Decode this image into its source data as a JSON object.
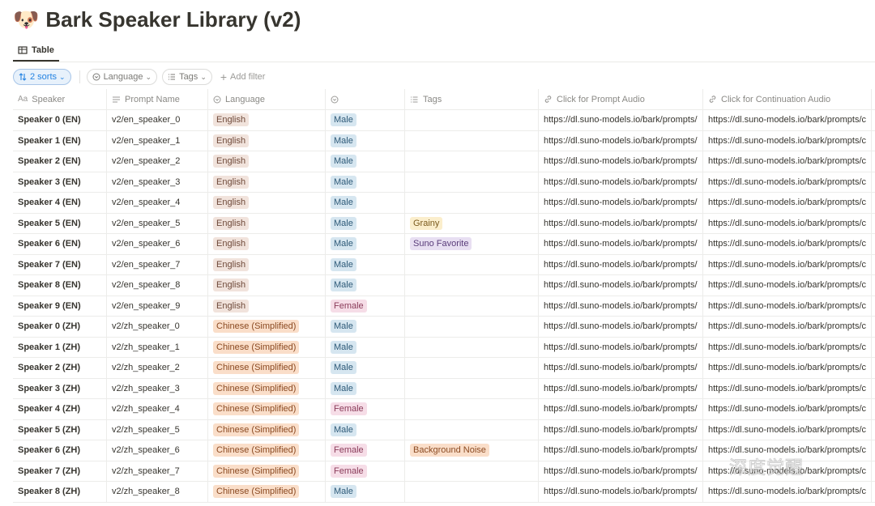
{
  "page": {
    "icon": "🐶",
    "title": "Bark Speaker Library (v2)"
  },
  "tabs": [
    {
      "label": "Table",
      "icon": "table-icon"
    }
  ],
  "filters": {
    "sort_label": "2 sorts",
    "language_label": "Language",
    "tags_label": "Tags",
    "add_filter_label": "Add filter"
  },
  "columns": [
    {
      "label": "Speaker",
      "icon": "text-icon"
    },
    {
      "label": "Prompt Name",
      "icon": "lines-icon"
    },
    {
      "label": "Language",
      "icon": "select-icon"
    },
    {
      "label": "",
      "icon": "select-icon"
    },
    {
      "label": "Tags",
      "icon": "list-icon"
    },
    {
      "label": "Click for Prompt Audio",
      "icon": "link-icon"
    },
    {
      "label": "Click for Continuation Audio",
      "icon": "link-icon"
    }
  ],
  "rows": [
    {
      "speaker": "Speaker 0 (EN)",
      "prompt": "v2/en_speaker_0",
      "language": "English",
      "gender": "Male",
      "tag": "",
      "prompt_url": "https://dl.suno-models.io/bark/prompts/",
      "cont_url": "https://dl.suno-models.io/bark/prompts/c"
    },
    {
      "speaker": "Speaker 1 (EN)",
      "prompt": "v2/en_speaker_1",
      "language": "English",
      "gender": "Male",
      "tag": "",
      "prompt_url": "https://dl.suno-models.io/bark/prompts/",
      "cont_url": "https://dl.suno-models.io/bark/prompts/c"
    },
    {
      "speaker": "Speaker 2 (EN)",
      "prompt": "v2/en_speaker_2",
      "language": "English",
      "gender": "Male",
      "tag": "",
      "prompt_url": "https://dl.suno-models.io/bark/prompts/",
      "cont_url": "https://dl.suno-models.io/bark/prompts/c"
    },
    {
      "speaker": "Speaker 3 (EN)",
      "prompt": "v2/en_speaker_3",
      "language": "English",
      "gender": "Male",
      "tag": "",
      "prompt_url": "https://dl.suno-models.io/bark/prompts/",
      "cont_url": "https://dl.suno-models.io/bark/prompts/c"
    },
    {
      "speaker": "Speaker 4 (EN)",
      "prompt": "v2/en_speaker_4",
      "language": "English",
      "gender": "Male",
      "tag": "",
      "prompt_url": "https://dl.suno-models.io/bark/prompts/",
      "cont_url": "https://dl.suno-models.io/bark/prompts/c"
    },
    {
      "speaker": "Speaker 5 (EN)",
      "prompt": "v2/en_speaker_5",
      "language": "English",
      "gender": "Male",
      "tag": "Grainy",
      "prompt_url": "https://dl.suno-models.io/bark/prompts/",
      "cont_url": "https://dl.suno-models.io/bark/prompts/c"
    },
    {
      "speaker": "Speaker 6 (EN)",
      "prompt": "v2/en_speaker_6",
      "language": "English",
      "gender": "Male",
      "tag": "Suno Favorite",
      "prompt_url": "https://dl.suno-models.io/bark/prompts/",
      "cont_url": "https://dl.suno-models.io/bark/prompts/c"
    },
    {
      "speaker": "Speaker 7 (EN)",
      "prompt": "v2/en_speaker_7",
      "language": "English",
      "gender": "Male",
      "tag": "",
      "prompt_url": "https://dl.suno-models.io/bark/prompts/",
      "cont_url": "https://dl.suno-models.io/bark/prompts/c"
    },
    {
      "speaker": "Speaker 8 (EN)",
      "prompt": "v2/en_speaker_8",
      "language": "English",
      "gender": "Male",
      "tag": "",
      "prompt_url": "https://dl.suno-models.io/bark/prompts/",
      "cont_url": "https://dl.suno-models.io/bark/prompts/c"
    },
    {
      "speaker": "Speaker 9 (EN)",
      "prompt": "v2/en_speaker_9",
      "language": "English",
      "gender": "Female",
      "tag": "",
      "prompt_url": "https://dl.suno-models.io/bark/prompts/",
      "cont_url": "https://dl.suno-models.io/bark/prompts/c"
    },
    {
      "speaker": "Speaker 0 (ZH)",
      "prompt": "v2/zh_speaker_0",
      "language": "Chinese (Simplified)",
      "gender": "Male",
      "tag": "",
      "prompt_url": "https://dl.suno-models.io/bark/prompts/",
      "cont_url": "https://dl.suno-models.io/bark/prompts/c"
    },
    {
      "speaker": "Speaker 1 (ZH)",
      "prompt": "v2/zh_speaker_1",
      "language": "Chinese (Simplified)",
      "gender": "Male",
      "tag": "",
      "prompt_url": "https://dl.suno-models.io/bark/prompts/",
      "cont_url": "https://dl.suno-models.io/bark/prompts/c"
    },
    {
      "speaker": "Speaker 2 (ZH)",
      "prompt": "v2/zh_speaker_2",
      "language": "Chinese (Simplified)",
      "gender": "Male",
      "tag": "",
      "prompt_url": "https://dl.suno-models.io/bark/prompts/",
      "cont_url": "https://dl.suno-models.io/bark/prompts/c"
    },
    {
      "speaker": "Speaker 3 (ZH)",
      "prompt": "v2/zh_speaker_3",
      "language": "Chinese (Simplified)",
      "gender": "Male",
      "tag": "",
      "prompt_url": "https://dl.suno-models.io/bark/prompts/",
      "cont_url": "https://dl.suno-models.io/bark/prompts/c"
    },
    {
      "speaker": "Speaker 4 (ZH)",
      "prompt": "v2/zh_speaker_4",
      "language": "Chinese (Simplified)",
      "gender": "Female",
      "tag": "",
      "prompt_url": "https://dl.suno-models.io/bark/prompts/",
      "cont_url": "https://dl.suno-models.io/bark/prompts/c"
    },
    {
      "speaker": "Speaker 5 (ZH)",
      "prompt": "v2/zh_speaker_5",
      "language": "Chinese (Simplified)",
      "gender": "Male",
      "tag": "",
      "prompt_url": "https://dl.suno-models.io/bark/prompts/",
      "cont_url": "https://dl.suno-models.io/bark/prompts/c"
    },
    {
      "speaker": "Speaker 6 (ZH)",
      "prompt": "v2/zh_speaker_6",
      "language": "Chinese (Simplified)",
      "gender": "Female",
      "tag": "Background Noise",
      "prompt_url": "https://dl.suno-models.io/bark/prompts/",
      "cont_url": "https://dl.suno-models.io/bark/prompts/c"
    },
    {
      "speaker": "Speaker 7 (ZH)",
      "prompt": "v2/zh_speaker_7",
      "language": "Chinese (Simplified)",
      "gender": "Female",
      "tag": "",
      "prompt_url": "https://dl.suno-models.io/bark/prompts/",
      "cont_url": "https://dl.suno-models.io/bark/prompts/c"
    },
    {
      "speaker": "Speaker 8 (ZH)",
      "prompt": "v2/zh_speaker_8",
      "language": "Chinese (Simplified)",
      "gender": "Male",
      "tag": "",
      "prompt_url": "https://dl.suno-models.io/bark/prompts/",
      "cont_url": "https://dl.suno-models.io/bark/prompts/c"
    }
  ],
  "watermark": "深度觉醒"
}
